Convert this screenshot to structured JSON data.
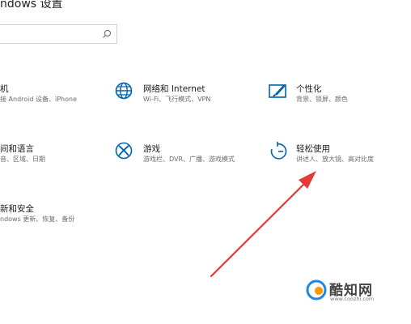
{
  "window": {
    "title": "ndows 设置"
  },
  "search": {
    "placeholder": ""
  },
  "tiles": {
    "phone": {
      "name": "机",
      "desc": "接 Android 设备、iPhone"
    },
    "network": {
      "name": "网络和 Internet",
      "desc": "Wi-Fi、飞行模式、VPN"
    },
    "personal": {
      "name": "个性化",
      "desc": "背景、锁屏、颜色"
    },
    "time": {
      "name": "间和语言",
      "desc": "音、区域、日期"
    },
    "gaming": {
      "name": "游戏",
      "desc": "游戏栏、DVR、广播、游戏模式"
    },
    "ease": {
      "name": "轻松使用",
      "desc": "讲述人、放大镜、高对比度"
    },
    "update": {
      "name": "新和安全",
      "desc": "ndows 更新、恢复、备份"
    }
  },
  "icons": {
    "network": "globe-icon",
    "personal": "paint-brush-icon",
    "gaming": "xbox-icon",
    "ease": "ease-of-access-icon",
    "search": "search-icon"
  },
  "colors": {
    "accent": "#0063b1",
    "arrow": "#e53935"
  },
  "watermark": {
    "name": "酷知网",
    "url": "www.coozhi.com"
  }
}
